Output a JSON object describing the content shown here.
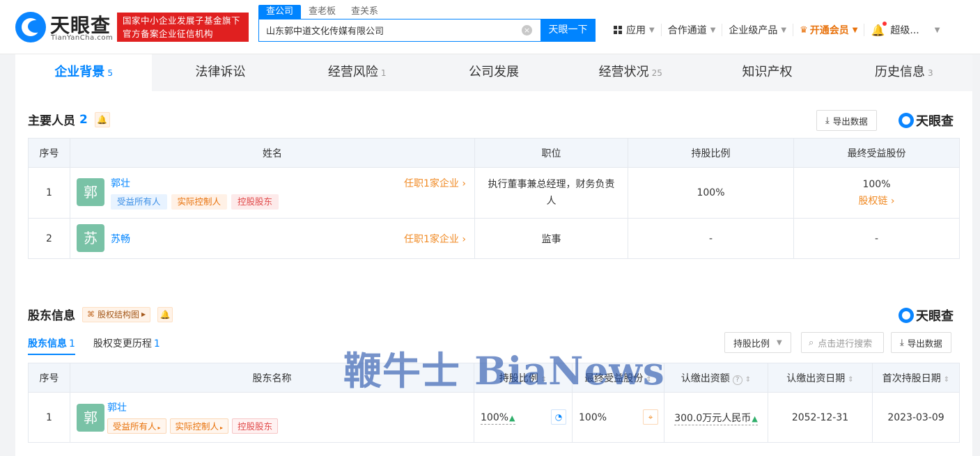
{
  "header": {
    "logo_cn": "天眼查",
    "logo_en": "TianYanCha.com",
    "gov_badge_line1": "国家中小企业发展子基金旗下",
    "gov_badge_line2": "官方备案企业征信机构",
    "search_tabs": [
      "查公司",
      "查老板",
      "查关系"
    ],
    "search_value": "山东郭中道文化传媒有限公司",
    "search_button": "天眼一下",
    "nav": {
      "apps": "应用",
      "cooperation": "合作通道",
      "enterprise": "企业级产品",
      "vip": "开通会员",
      "user": "超级..."
    }
  },
  "tabs": [
    {
      "label": "企业背景",
      "count": "5"
    },
    {
      "label": "法律诉讼",
      "count": ""
    },
    {
      "label": "经营风险",
      "count": "1"
    },
    {
      "label": "公司发展",
      "count": ""
    },
    {
      "label": "经营状况",
      "count": "25"
    },
    {
      "label": "知识产权",
      "count": ""
    },
    {
      "label": "历史信息",
      "count": "3"
    }
  ],
  "personnel": {
    "title": "主要人员",
    "count": "2",
    "export": "导出数据",
    "brand": "天眼查",
    "columns": [
      "序号",
      "姓名",
      "职位",
      "持股比例",
      "最终受益股份"
    ],
    "rows": [
      {
        "index": "1",
        "avatar": "郭",
        "name": "郭壮",
        "tags": [
          "受益所有人",
          "实际控制人",
          "控股股东"
        ],
        "positions": "任职1家企业",
        "title_line1": "执行董事兼总经理，财务负责",
        "title_line2": "人",
        "shareholding": "100%",
        "final_benefit": "100%",
        "equity_chain": "股权链"
      },
      {
        "index": "2",
        "avatar": "苏",
        "name": "苏畅",
        "tags": [],
        "positions": "任职1家企业",
        "title_line1": "监事",
        "title_line2": "",
        "shareholding": "-",
        "final_benefit": "-",
        "equity_chain": ""
      }
    ]
  },
  "shareholders": {
    "title": "股东信息",
    "structure_button": "股权结构图",
    "brand": "天眼查",
    "sub_tabs": [
      {
        "label": "股东信息",
        "count": "1"
      },
      {
        "label": "股权变更历程",
        "count": "1"
      }
    ],
    "filter_select": "持股比例",
    "search_placeholder": "点击进行搜索",
    "export": "导出数据",
    "columns": [
      "序号",
      "股东名称",
      "持股比例",
      "最终受益股份",
      "认缴出资额",
      "认缴出资日期",
      "首次持股日期"
    ],
    "rows": [
      {
        "index": "1",
        "avatar": "郭",
        "name": "郭壮",
        "tags": [
          "受益所有人",
          "实际控制人",
          "控股股东"
        ],
        "shareholding": "100%",
        "final_benefit": "100%",
        "subscribed_amount": "300.0万元人民币",
        "subscribed_date": "2052-12-31",
        "first_holding_date": "2023-03-09"
      }
    ]
  },
  "watermark": "鞭牛士 BiaNews"
}
